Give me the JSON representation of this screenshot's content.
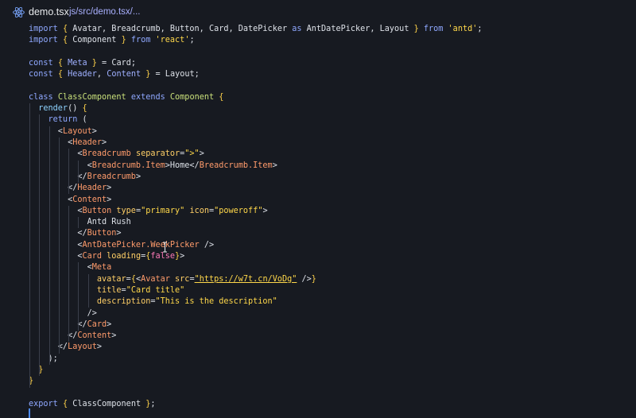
{
  "tab": {
    "file_name": "demo.tsx",
    "path": "js/src/demo.tsx/..."
  },
  "code": [
    [
      [
        "import ",
        "kw"
      ],
      [
        "{ ",
        "br"
      ],
      [
        "Avatar, Breadcrumb, Button, Card, DatePicker ",
        "pn"
      ],
      [
        "as",
        "kw"
      ],
      [
        " AntDatePicker, Layout ",
        "pn"
      ],
      [
        "}",
        "br"
      ],
      [
        " from ",
        "kw"
      ],
      [
        "'antd'",
        "str"
      ],
      [
        ";",
        "pn"
      ]
    ],
    [
      [
        "import ",
        "kw"
      ],
      [
        "{ ",
        "br"
      ],
      [
        "Component ",
        "pn"
      ],
      [
        "}",
        "br"
      ],
      [
        " from ",
        "kw"
      ],
      [
        "'react'",
        "str"
      ],
      [
        ";",
        "pn"
      ]
    ],
    [],
    [
      [
        "const ",
        "kw"
      ],
      [
        "{ ",
        "br"
      ],
      [
        "Meta",
        "prop"
      ],
      [
        " ",
        "pn"
      ],
      [
        "}",
        "br"
      ],
      [
        " = Card;",
        "pn"
      ]
    ],
    [
      [
        "const ",
        "kw"
      ],
      [
        "{ ",
        "br"
      ],
      [
        "Header",
        "prop"
      ],
      [
        ", ",
        "pn"
      ],
      [
        "Content",
        "prop"
      ],
      [
        " ",
        "pn"
      ],
      [
        "}",
        "br"
      ],
      [
        " = Layout;",
        "pn"
      ]
    ],
    [],
    [
      [
        "class ",
        "kw"
      ],
      [
        "ClassComponent ",
        "cls"
      ],
      [
        "extends ",
        "kw"
      ],
      [
        "Component ",
        "cls"
      ],
      [
        "{",
        "br"
      ]
    ],
    [
      [
        "  render",
        "fn"
      ],
      [
        "() ",
        "pn"
      ],
      [
        "{",
        "br"
      ]
    ],
    [
      [
        "    return ",
        "kw"
      ],
      [
        "(",
        "pn"
      ]
    ],
    [
      [
        "      <",
        "pn"
      ],
      [
        "Layout",
        "tag"
      ],
      [
        ">",
        "pn"
      ]
    ],
    [
      [
        "        <",
        "pn"
      ],
      [
        "Header",
        "tag"
      ],
      [
        ">",
        "pn"
      ]
    ],
    [
      [
        "          <",
        "pn"
      ],
      [
        "Breadcrumb ",
        "tag"
      ],
      [
        "separator",
        "attr"
      ],
      [
        "=",
        "pn"
      ],
      [
        "\">\"",
        "str"
      ],
      [
        ">",
        "pn"
      ]
    ],
    [
      [
        "            <",
        "pn"
      ],
      [
        "Breadcrumb.Item",
        "tag"
      ],
      [
        ">Home</",
        "pn"
      ],
      [
        "Breadcrumb.Item",
        "tag"
      ],
      [
        ">",
        "pn"
      ]
    ],
    [
      [
        "          </",
        "pn"
      ],
      [
        "Breadcrumb",
        "tag"
      ],
      [
        ">",
        "pn"
      ]
    ],
    [
      [
        "        </",
        "pn"
      ],
      [
        "Header",
        "tag"
      ],
      [
        ">",
        "pn"
      ]
    ],
    [
      [
        "        <",
        "pn"
      ],
      [
        "Content",
        "tag"
      ],
      [
        ">",
        "pn"
      ]
    ],
    [
      [
        "          <",
        "pn"
      ],
      [
        "Button ",
        "tag"
      ],
      [
        "type",
        "attr"
      ],
      [
        "=",
        "pn"
      ],
      [
        "\"primary\"",
        "str"
      ],
      [
        " ",
        "pn"
      ],
      [
        "icon",
        "attr"
      ],
      [
        "=",
        "pn"
      ],
      [
        "\"poweroff\"",
        "str"
      ],
      [
        ">",
        "pn"
      ]
    ],
    [
      [
        "            Antd Rush",
        "pn"
      ]
    ],
    [
      [
        "          </",
        "pn"
      ],
      [
        "Button",
        "tag"
      ],
      [
        ">",
        "pn"
      ]
    ],
    [
      [
        "          <",
        "pn"
      ],
      [
        "AntDatePicker.WeekPicker ",
        "tag"
      ],
      [
        "/>",
        "pn"
      ]
    ],
    [
      [
        "          <",
        "pn"
      ],
      [
        "Card ",
        "tag"
      ],
      [
        "loading",
        "attr"
      ],
      [
        "=",
        "pn"
      ],
      [
        "{",
        "br"
      ],
      [
        "false",
        "bool"
      ],
      [
        "}",
        "br"
      ],
      [
        ">",
        "pn"
      ]
    ],
    [
      [
        "            <",
        "pn"
      ],
      [
        "Meta",
        "tag"
      ]
    ],
    [
      [
        "              avatar",
        "attr"
      ],
      [
        "=",
        "pn"
      ],
      [
        "{",
        "br"
      ],
      [
        "<",
        "pn"
      ],
      [
        "Avatar ",
        "tag"
      ],
      [
        "src",
        "attr"
      ],
      [
        "=",
        "pn"
      ],
      [
        "\"https://w7t.cn/VoDg\"",
        "str"
      ],
      [
        " />",
        "pn"
      ],
      [
        "}",
        "br"
      ]
    ],
    [
      [
        "              title",
        "attr"
      ],
      [
        "=",
        "pn"
      ],
      [
        "\"Card title\"",
        "str"
      ]
    ],
    [
      [
        "              description",
        "attr"
      ],
      [
        "=",
        "pn"
      ],
      [
        "\"This is the description\"",
        "str"
      ]
    ],
    [
      [
        "            />",
        "pn"
      ]
    ],
    [
      [
        "          </",
        "pn"
      ],
      [
        "Card",
        "tag"
      ],
      [
        ">",
        "pn"
      ]
    ],
    [
      [
        "        </",
        "pn"
      ],
      [
        "Content",
        "tag"
      ],
      [
        ">",
        "pn"
      ]
    ],
    [
      [
        "      </",
        "pn"
      ],
      [
        "Layout",
        "tag"
      ],
      [
        ">",
        "pn"
      ]
    ],
    [
      [
        "    );",
        "pn"
      ]
    ],
    [
      [
        "  }",
        "br"
      ]
    ],
    [
      [
        "}",
        "br"
      ]
    ],
    [],
    [
      [
        "export ",
        "kw"
      ],
      [
        "{ ",
        "br"
      ],
      [
        "ClassComponent ",
        "pn"
      ],
      [
        "}",
        "br"
      ],
      [
        ";",
        "pn"
      ]
    ]
  ],
  "colors": {
    "background": "#171a21",
    "keyword": "#8fa8ff",
    "string": "#ffd84a",
    "tag": "#ff9b6b",
    "class": "#c9e07a",
    "bracket": "#ffd24a",
    "cursor": "#4e8cff"
  },
  "icons": {
    "file_icon": "react-icon"
  }
}
